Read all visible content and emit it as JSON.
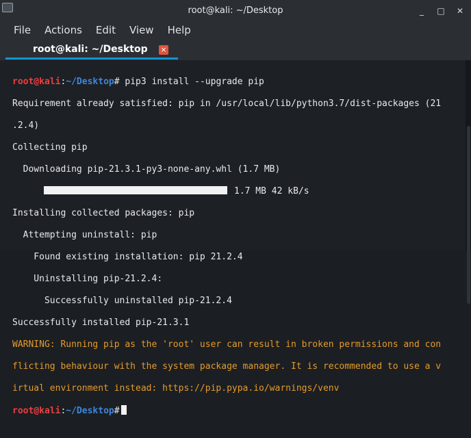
{
  "window": {
    "title": "root@kali: ~/Desktop",
    "minimize_label": "_",
    "maximize_label": "□",
    "close_label": "✕"
  },
  "menubar": {
    "file": "File",
    "actions": "Actions",
    "edit": "Edit",
    "view": "View",
    "help": "Help"
  },
  "tab": {
    "label": "root@kali: ~/Desktop",
    "close_label": "×"
  },
  "prompt": {
    "user": "root@kali",
    "sep": ":",
    "path": "~/Desktop",
    "symbol": "#"
  },
  "terminal": {
    "command_1": " pip3 install --upgrade pip",
    "line_2": "Requirement already satisfied: pip in /usr/local/lib/python3.7/dist-packages (21",
    "line_3": ".2.4)",
    "line_4": "Collecting pip",
    "line_5": "  Downloading pip-21.3.1-py3-none-any.whl (1.7 MB)",
    "progress_text": "1.7 MB 42 kB/s",
    "progress_fraction": 1.0,
    "line_7": "Installing collected packages: pip",
    "line_8": "  Attempting uninstall: pip",
    "line_9": "    Found existing installation: pip 21.2.4",
    "line_10": "    Uninstalling pip-21.2.4:",
    "line_11": "      Successfully uninstalled pip-21.2.4",
    "line_12": "Successfully installed pip-21.3.1",
    "warning_1": "WARNING: Running pip as the 'root' user can result in broken permissions and con",
    "warning_2": "flicting behaviour with the system package manager. It is recommended to use a v",
    "warning_3": "irtual environment instead: https://pip.pypa.io/warnings/venv"
  },
  "colors": {
    "prompt_user": "#ea3f3f",
    "prompt_path": "#3f86d8",
    "warning": "#e69a2b",
    "tab_accent": "#1793d1",
    "tab_close": "#e0553d"
  }
}
